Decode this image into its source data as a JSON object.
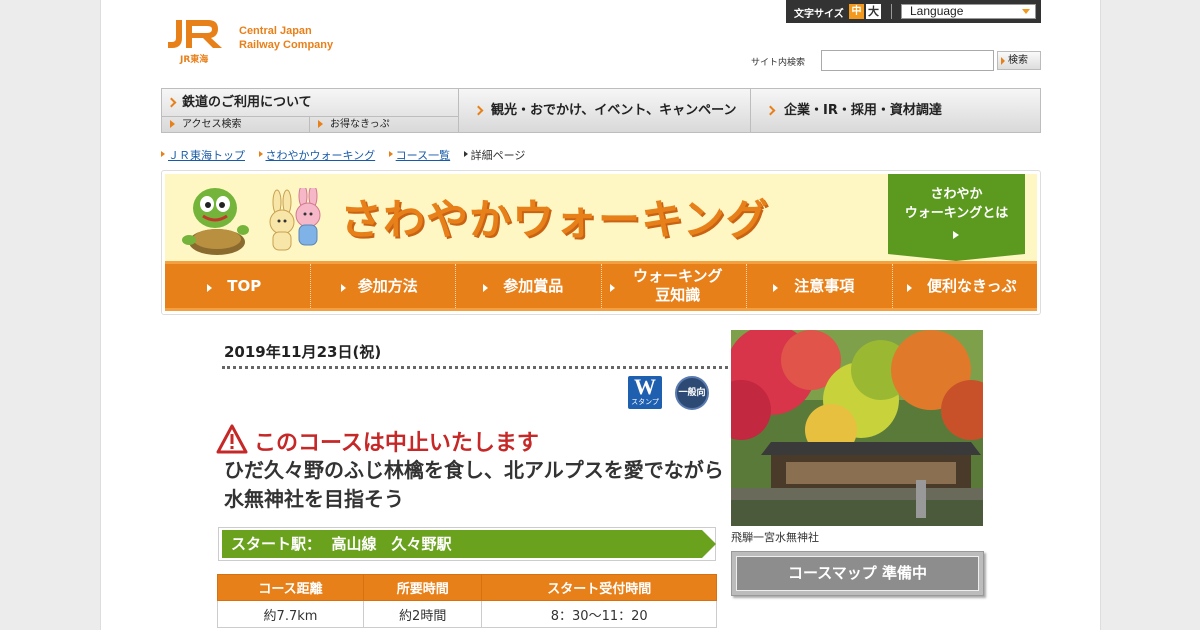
{
  "header": {
    "logo_mark": "JR",
    "logo_sub": "JR東海",
    "logo_line1": "Central Japan",
    "logo_line2": "Railway Company",
    "font_size_label": "文字サイズ",
    "font_size_medium": "中",
    "font_size_large": "大",
    "language_label": "Language",
    "site_search_label": "サイト内検索",
    "search_placeholder": "",
    "search_button": "検索"
  },
  "global_nav": {
    "railway_use": "鉄道のご利用について",
    "access_search": "アクセス検索",
    "value_tickets": "お得なきっぷ",
    "sightseeing": "観光・おでかけ、イベント、キャンペーン",
    "corporate": "企業・IR・採用・資材調達"
  },
  "breadcrumb": {
    "items": [
      "ＪＲ東海トップ",
      "さわやかウォーキング",
      "コース一覧"
    ],
    "current": "詳細ページ"
  },
  "banner": {
    "title": "さわやかウォーキング",
    "about_line1": "さわやか",
    "about_line2": "ウォーキングとは"
  },
  "sub_nav": {
    "items": [
      {
        "line1": "TOP",
        "line2": ""
      },
      {
        "line1": "参加方法",
        "line2": ""
      },
      {
        "line1": "参加賞品",
        "line2": ""
      },
      {
        "line1": "ウォーキング",
        "line2": "豆知識"
      },
      {
        "line1": "注意事項",
        "line2": ""
      },
      {
        "line1": "便利なきっぷ",
        "line2": ""
      }
    ]
  },
  "course": {
    "date": "2019年11月23日(祝)",
    "stamp_w_letter": "W",
    "stamp_w_label": "スタンプ",
    "stamp_general": "一般向",
    "cancel_notice": "このコースは中止いたします",
    "title": "ひだ久々野のふじ林檎を食し、北アルプスを愛でながら水無神社を目指そう",
    "start_station": "スタート駅：  高山線　久々野駅",
    "table_headers": [
      "コース距離",
      "所要時間",
      "スタート受付時間"
    ],
    "table_values": [
      "約7.7km",
      "約2時間",
      "8：30～11：20"
    ]
  },
  "side": {
    "photo_caption": "飛騨一宮水無神社",
    "map_button": "コースマップ 準備中"
  },
  "colors": {
    "brand_orange": "#e8801a",
    "green": "#6aa21e",
    "alert_red": "#c62828"
  }
}
